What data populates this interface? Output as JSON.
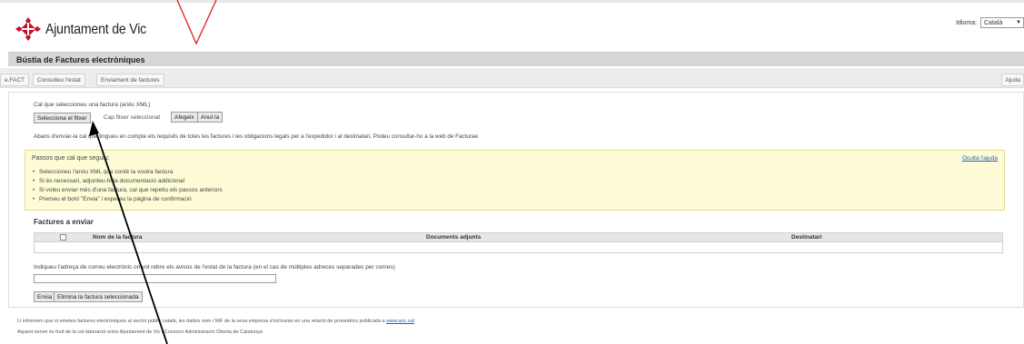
{
  "header": {
    "logo_text": "Ajuntament de Vic",
    "language_label": "Idioma:",
    "language_value": "Català"
  },
  "page_title": "Bústia de Factures electròniques",
  "tabs": [
    {
      "label": "e.FACT"
    },
    {
      "label": "Consulteu l'estat"
    },
    {
      "label": "Enviament de factures"
    }
  ],
  "help_tab": "Ajuda",
  "upload": {
    "instruction": "Cal que seleccioneu una factura (arxiu XML)",
    "select_button": "Selecciona el fitxer",
    "no_file_text": "Cap fitxer seleccionat",
    "add_button": "Afegeix",
    "cancel_button": "Anul·la"
  },
  "notice": "Abans d'enviar-la cal que tingueu en compte els requisits de totes les factures i les obligacions legals per a l'expedidor i al destinatari. Podeu consultar-ho a la web de Facturae",
  "help_box": {
    "title": "Passos que cal que seguiu:",
    "hide_link": "Oculta l'ajuda",
    "steps": [
      "Seleccioneu l'arxiu XML que conté la vostra factura",
      "Si és necessari, adjunteu-hi la documentació addicional",
      "Si voleu enviar més d'una factura, cal que repetiu els passos anteriors",
      "Premeu el botó \"Envia\" i espereu la pàgina de confirmació"
    ]
  },
  "invoices": {
    "title": "Factures a enviar",
    "columns": [
      "Nom de la factura",
      "Documents adjunts",
      "Destinatari"
    ]
  },
  "email": {
    "label": "Indiqueu l'adreça de correu electrònic on vol rebre els avisos de l'estat de la factura (en el cas de múltiples adreces separades per comes)",
    "value": ""
  },
  "actions": {
    "send_button": "Envia",
    "delete_button": "Elimina la factura seleccionada"
  },
  "footer": {
    "line1": "Li informem que si emeteu factures electròniques al sector públic català, les dades nom i NIF de la seva empresa s'inclouran en una relació de proveïdors publicada a",
    "link": "www.aoc.cat",
    "line2": "Aquest servei és fruit de la col·laboració entre Ajuntament de Vic i Consorci Administració Oberta de Catalunya"
  },
  "colors": {
    "annotation_red": "#e02020",
    "annotation_black": "#000000",
    "help_background": "#fdfcd6",
    "link_blue": "#2a5db0"
  }
}
